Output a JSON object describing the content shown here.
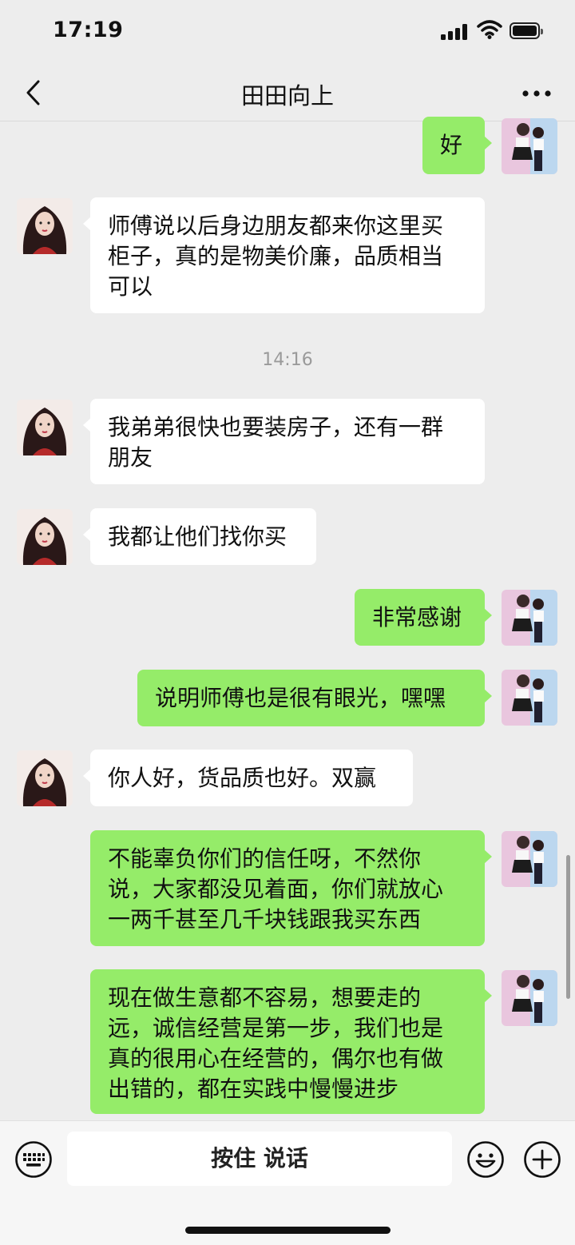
{
  "status": {
    "time": "17:19"
  },
  "nav": {
    "title": "田田向上",
    "back_icon": "chevron-left-icon",
    "more_icon": "more-dots-icon"
  },
  "messages": [
    {
      "side": "sent",
      "text": "好"
    },
    {
      "side": "received",
      "lines": [
        "师傅说以后身边朋友都来你这里买",
        "柜子，真的是物美价廉，品质相当",
        "可以"
      ]
    },
    {
      "side": "received",
      "lines": [
        "我弟弟很快也要装房子，还有一群",
        "朋友"
      ]
    },
    {
      "side": "received",
      "text": "我都让他们找你买"
    },
    {
      "side": "sent",
      "text": "非常感谢"
    },
    {
      "side": "sent",
      "text": "说明师傅也是很有眼光，嘿嘿"
    },
    {
      "side": "received",
      "text": "你人好，货品质也好。双赢"
    },
    {
      "side": "sent",
      "lines": [
        "不能辜负你们的信任呀，不然你",
        "说，大家都没见着面，你们就放心",
        "一两千甚至几千块钱跟我买东西"
      ]
    },
    {
      "side": "sent",
      "lines": [
        "现在做生意都不容易，想要走的",
        "远，诚信经营是第一步，我们也是",
        "真的很用心在经营的，偶尔也有做",
        "出错的，都在实践中慢慢进步"
      ]
    }
  ],
  "timestamp": "14:16",
  "input_bar": {
    "hold_to_talk": "按住 说话",
    "left_icon": "keyboard-icon",
    "emoji_icon": "emoji-icon",
    "plus_icon": "plus-icon"
  },
  "colors": {
    "background": "#ededed",
    "sent_bubble": "#95ec69",
    "received_bubble": "#ffffff"
  }
}
